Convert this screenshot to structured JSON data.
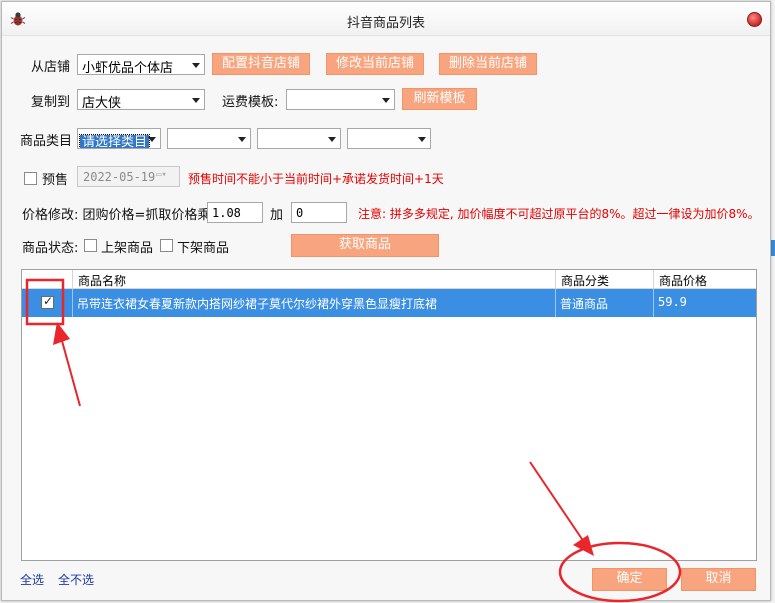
{
  "window": {
    "title": "抖音商品列表"
  },
  "shop": {
    "label": "从店铺",
    "value": "小虾优品个体店",
    "btn_config": "配置抖音店铺",
    "btn_edit": "修改当前店铺",
    "btn_delete": "删除当前店铺"
  },
  "copy": {
    "label": "复制到",
    "value": "店大侠",
    "freight_label": "运费模板:",
    "freight_value": "",
    "btn_refresh": "刷新模板"
  },
  "category": {
    "label": "商品类目",
    "value": "请选择类目",
    "sub1": "",
    "sub2": "",
    "sub3": ""
  },
  "presale": {
    "label": "预售",
    "date": "2022-05-19",
    "warning": "预售时间不能小于当前时间+承诺发货时间+1天"
  },
  "price": {
    "label": "价格修改: 团购价格=抓取价格乘",
    "multiplier": "1.08",
    "add_label": "加",
    "add_value": "0",
    "note": "注意: 拼多多规定, 加价幅度不可超过原平台的8%。超过一律设为加价8%。"
  },
  "status": {
    "label": "商品状态:",
    "on_shelf": "上架商品",
    "off_shelf": "下架商品",
    "btn_fetch": "获取商品"
  },
  "table": {
    "headers": [
      "",
      "商品名称",
      "商品分类",
      "商品价格"
    ],
    "rows": [
      {
        "checked": true,
        "name": "吊带连衣裙女春夏新款内搭网纱裙子莫代尔纱裙外穿黑色显瘦打底裙",
        "category": "普通商品",
        "price": "59.9"
      }
    ]
  },
  "footer": {
    "select_all": "全选",
    "select_none": "全不选",
    "ok": "确定",
    "cancel": "取消"
  },
  "colors": {
    "accent": "#f8a47e",
    "selection": "#3b8fe3",
    "warning": "#e60000",
    "annotation": "#e8262b"
  }
}
